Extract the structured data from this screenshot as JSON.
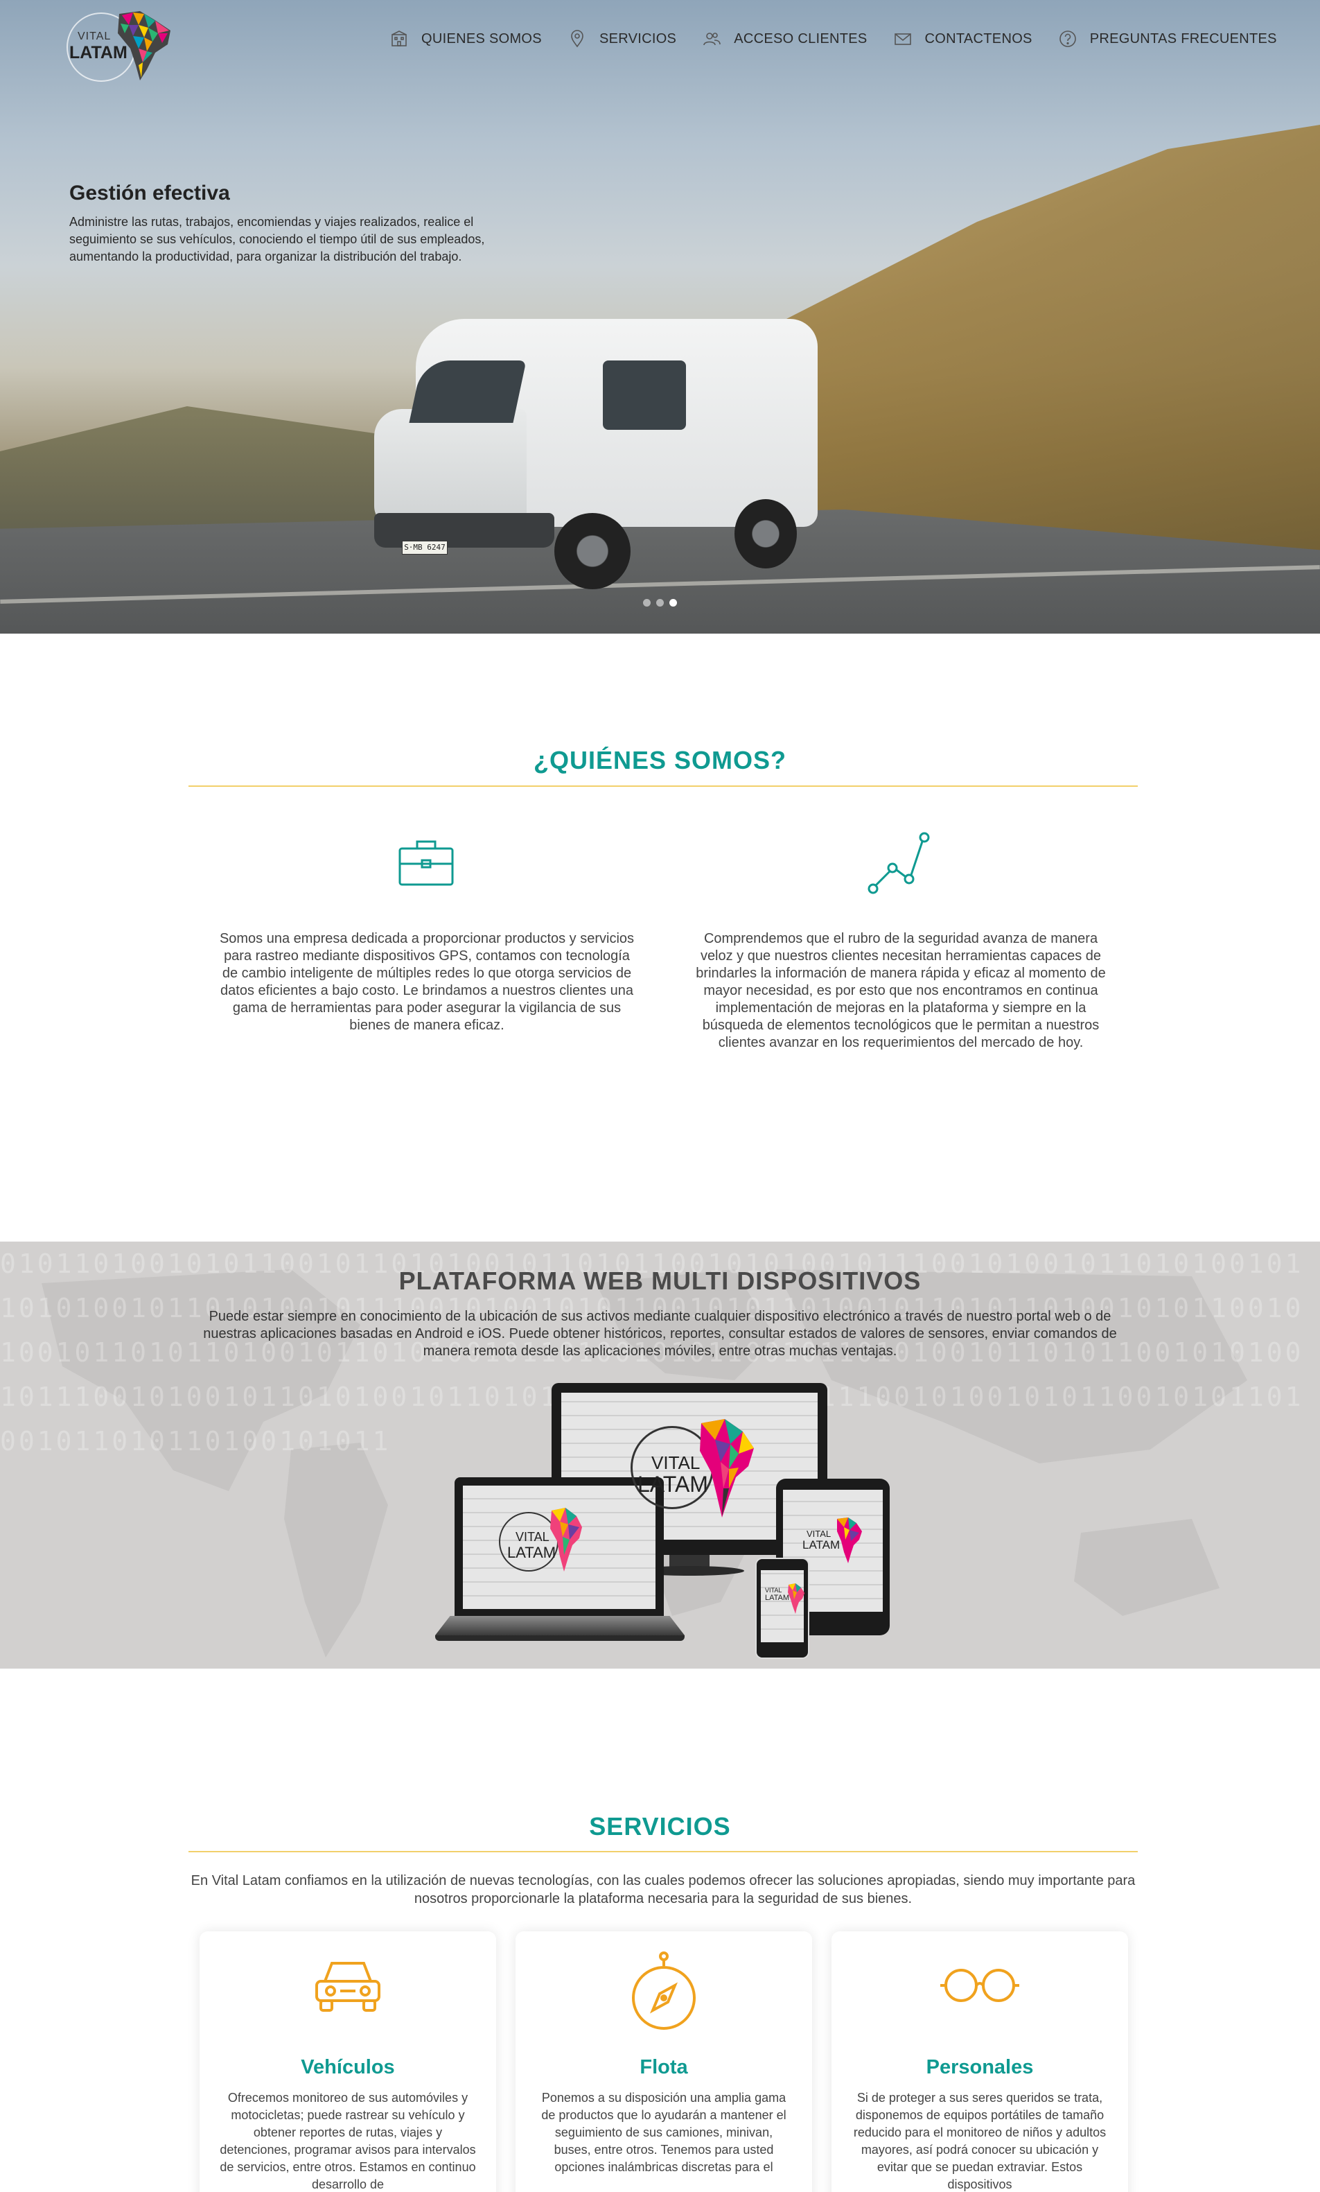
{
  "brand": {
    "logo_line1": "VITAL",
    "logo_line2": "LATAM"
  },
  "nav": {
    "items": [
      {
        "label": "QUIENES SOMOS",
        "icon": "building-icon"
      },
      {
        "label": "SERVICIOS",
        "icon": "map-pin-icon"
      },
      {
        "label": "ACCESO CLIENTES",
        "icon": "users-icon"
      },
      {
        "label": "CONTACTENOS",
        "icon": "envelope-icon"
      },
      {
        "label": "PREGUNTAS FRECUENTES",
        "icon": "question-circle-icon"
      }
    ]
  },
  "hero": {
    "title": "Gestión efectiva",
    "description": "Administre las rutas, trabajos, encomiendas y viajes realizados, realice el seguimiento se sus vehículos, conociendo el tiempo útil de sus empleados, aumentando la productividad, para organizar la distribución del trabajo.",
    "plate": "S·MB 6247",
    "slides": 3,
    "active_slide": 3
  },
  "about": {
    "title": "¿QUIÉNES SOMOS?",
    "left_text": "Somos una empresa dedicada a proporcionar productos y servicios para rastreo mediante dispositivos GPS, contamos con tecnología de cambio inteligente de múltiples redes lo que otorga servicios de datos eficientes a bajo costo. Le brindamos a nuestros clientes una gama de herramientas para poder asegurar la vigilancia de sus bienes de manera eficaz.",
    "right_text": "Comprendemos que el rubro de la seguridad avanza de manera veloz y que nuestros clientes necesitan herramientas capaces de brindarles la información de manera rápida y eficaz al momento de mayor necesidad, es por esto que nos encontramos en continua implementación de mejoras en la plataforma y siempre en la búsqueda de elementos tecnológicos que le permitan a nuestros clientes avanzar en los requerimientos del mercado de hoy.",
    "left_icon": "briefcase-icon",
    "right_icon": "line-chart-icon"
  },
  "platform": {
    "title": "PLATAFORMA WEB MULTI DISPOSITIVOS",
    "description": "Puede estar siempre en conocimiento de la ubicación de sus activos mediante cualquier dispositivo electrónico a través de nuestro portal web o de nuestras aplicaciones basadas en Android e iOS. Puede obtener históricos, reportes, consultar estados de valores de sensores, enviar comandos de manera remota desde las aplicaciones móviles, entre otras muchas ventajas.",
    "binary": "0101101001010110010110101001011010110010101001011100101001011010100101101010010110101001011100101001010110010101101001011010110100101011001010010110101101001011010100101101001010110010110101001011010110010101001011100101001011010100101101010010110101001011100101001010110010101101001011010110100101011"
  },
  "services": {
    "title": "SERVICIOS",
    "intro": "En Vital Latam confiamos en la utilización de nuevas tecnologías, con las cuales podemos ofrecer las soluciones apropiadas, siendo muy importante para nosotros proporcionarle la plataforma necesaria para la seguridad de sus bienes.",
    "cards": [
      {
        "title": "Vehículos",
        "icon": "car-icon",
        "text": "Ofrecemos monitoreo de sus automóviles y motocicletas; puede rastrear su vehículo y obtener reportes de rutas, viajes y detenciones, programar avisos para intervalos de servicios, entre otros. Estamos en continuo desarrollo de"
      },
      {
        "title": "Flota",
        "icon": "compass-icon",
        "text": "Ponemos a su disposición una amplia gama de productos que lo ayudarán a mantener el seguimiento de sus camiones, minivan, buses, entre otros. Tenemos para usted opciones inalámbricas discretas para el"
      },
      {
        "title": "Personales",
        "icon": "glasses-icon",
        "text": "Si de proteger a sus seres queridos se trata, disponemos de equipos portátiles de tamaño reducido para el monitoreo de niños y adultos mayores, así podrá conocer su ubicación y evitar que se puedan extraviar. Estos dispositivos"
      }
    ]
  },
  "colors": {
    "accent": "#0f9a91",
    "rule": "#f2d06b",
    "icon_orange": "#f0a21e"
  }
}
